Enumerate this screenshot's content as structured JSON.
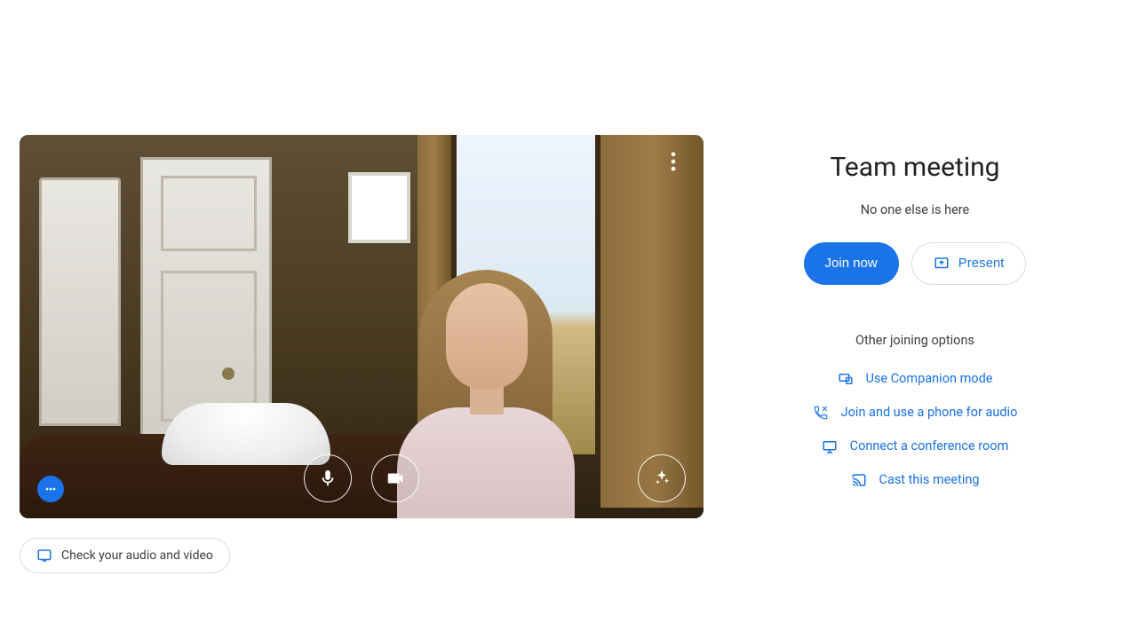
{
  "meeting": {
    "title": "Team meeting",
    "presence": "No one else is here",
    "join_label": "Join now",
    "present_label": "Present",
    "options_heading": "Other joining options"
  },
  "options": {
    "companion": "Use Companion mode",
    "phone": "Join and use a phone for audio",
    "conference_room": "Connect a conference room",
    "cast": "Cast this meeting"
  },
  "preview": {
    "check_av": "Check your audio and video"
  }
}
